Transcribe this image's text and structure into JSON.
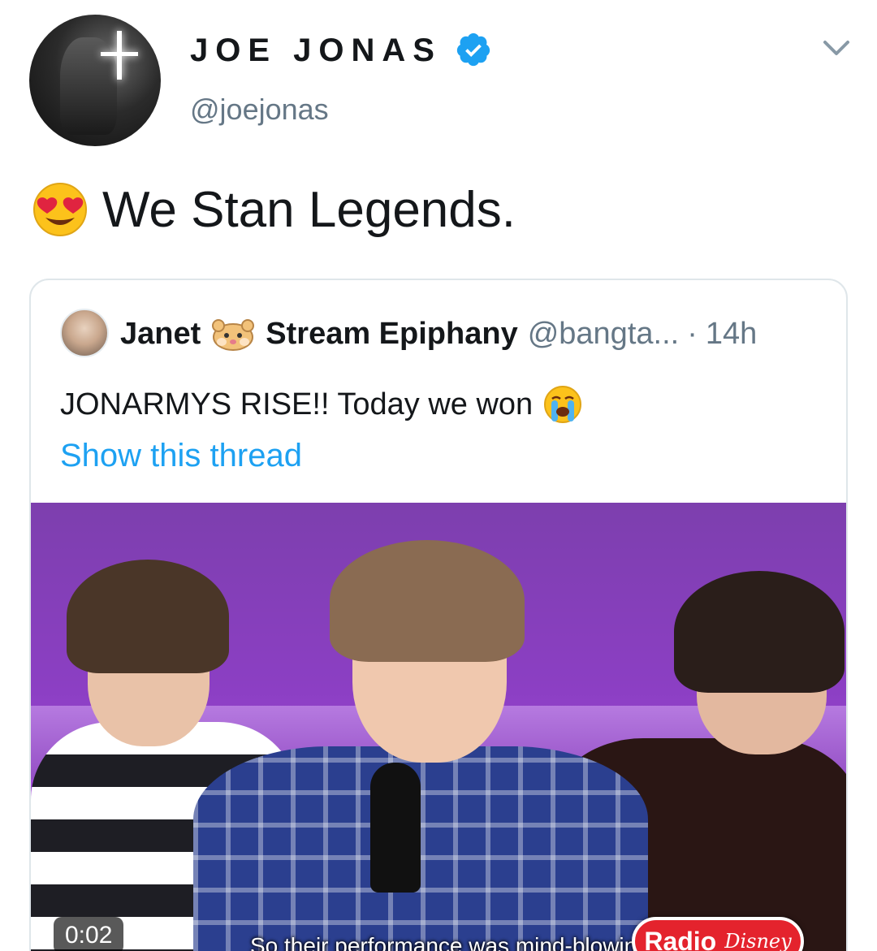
{
  "author": {
    "display_name": "JOE JONAS",
    "handle": "@joejonas",
    "verified": true
  },
  "tweet": {
    "emoji": "heart-eyes-emoji",
    "text": "We Stan Legends."
  },
  "quoted_tweet": {
    "name": "Janet",
    "name_suffix": "Stream Epiphany",
    "handle": "@bangta...",
    "separator": "·",
    "time": "14h",
    "text": "JONARMYS RISE!! Today we won",
    "show_thread_label": "Show this thread",
    "video": {
      "timer": "0:02",
      "subtitle": "So their performance was mind-blowing.",
      "logo_radio": "Radio",
      "logo_disney": "Disney"
    }
  },
  "colors": {
    "link": "#1da1f2",
    "verified": "#1da1f2",
    "muted": "#657786",
    "text": "#14171a",
    "border": "#dfe6ea"
  },
  "icons": {
    "verified": "verified-badge-icon",
    "caret": "chevron-down-icon",
    "hamster": "hamster-face-icon",
    "crying": "loudly-crying-face-icon"
  }
}
